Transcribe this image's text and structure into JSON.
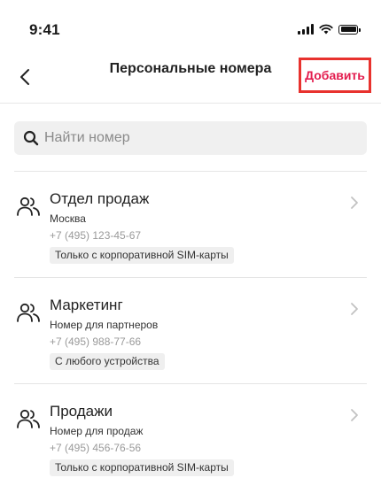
{
  "status_bar": {
    "time": "9:41"
  },
  "header": {
    "back_icon": "chevron-left-icon",
    "title": "Персональные номера",
    "add_label": "Добавить",
    "add_highlight_color": "#e8322e",
    "add_text_color": "#e31c4e"
  },
  "search": {
    "placeholder": "Найти номер",
    "value": ""
  },
  "items": [
    {
      "name": "Отдел продаж",
      "subtitle": "Москва",
      "phone": "+7 (495) 123-45-67",
      "badge": "Только с корпоративной SIM-карты"
    },
    {
      "name": "Маркетинг",
      "subtitle": "Номер для партнеров",
      "phone": "+7 (495) 988-77-66",
      "badge": "С любого устройства"
    },
    {
      "name": "Продажи",
      "subtitle": "Номер для продаж",
      "phone": "+7 (495) 456-76-56",
      "badge": "Только с корпоративной SIM-карты"
    }
  ]
}
